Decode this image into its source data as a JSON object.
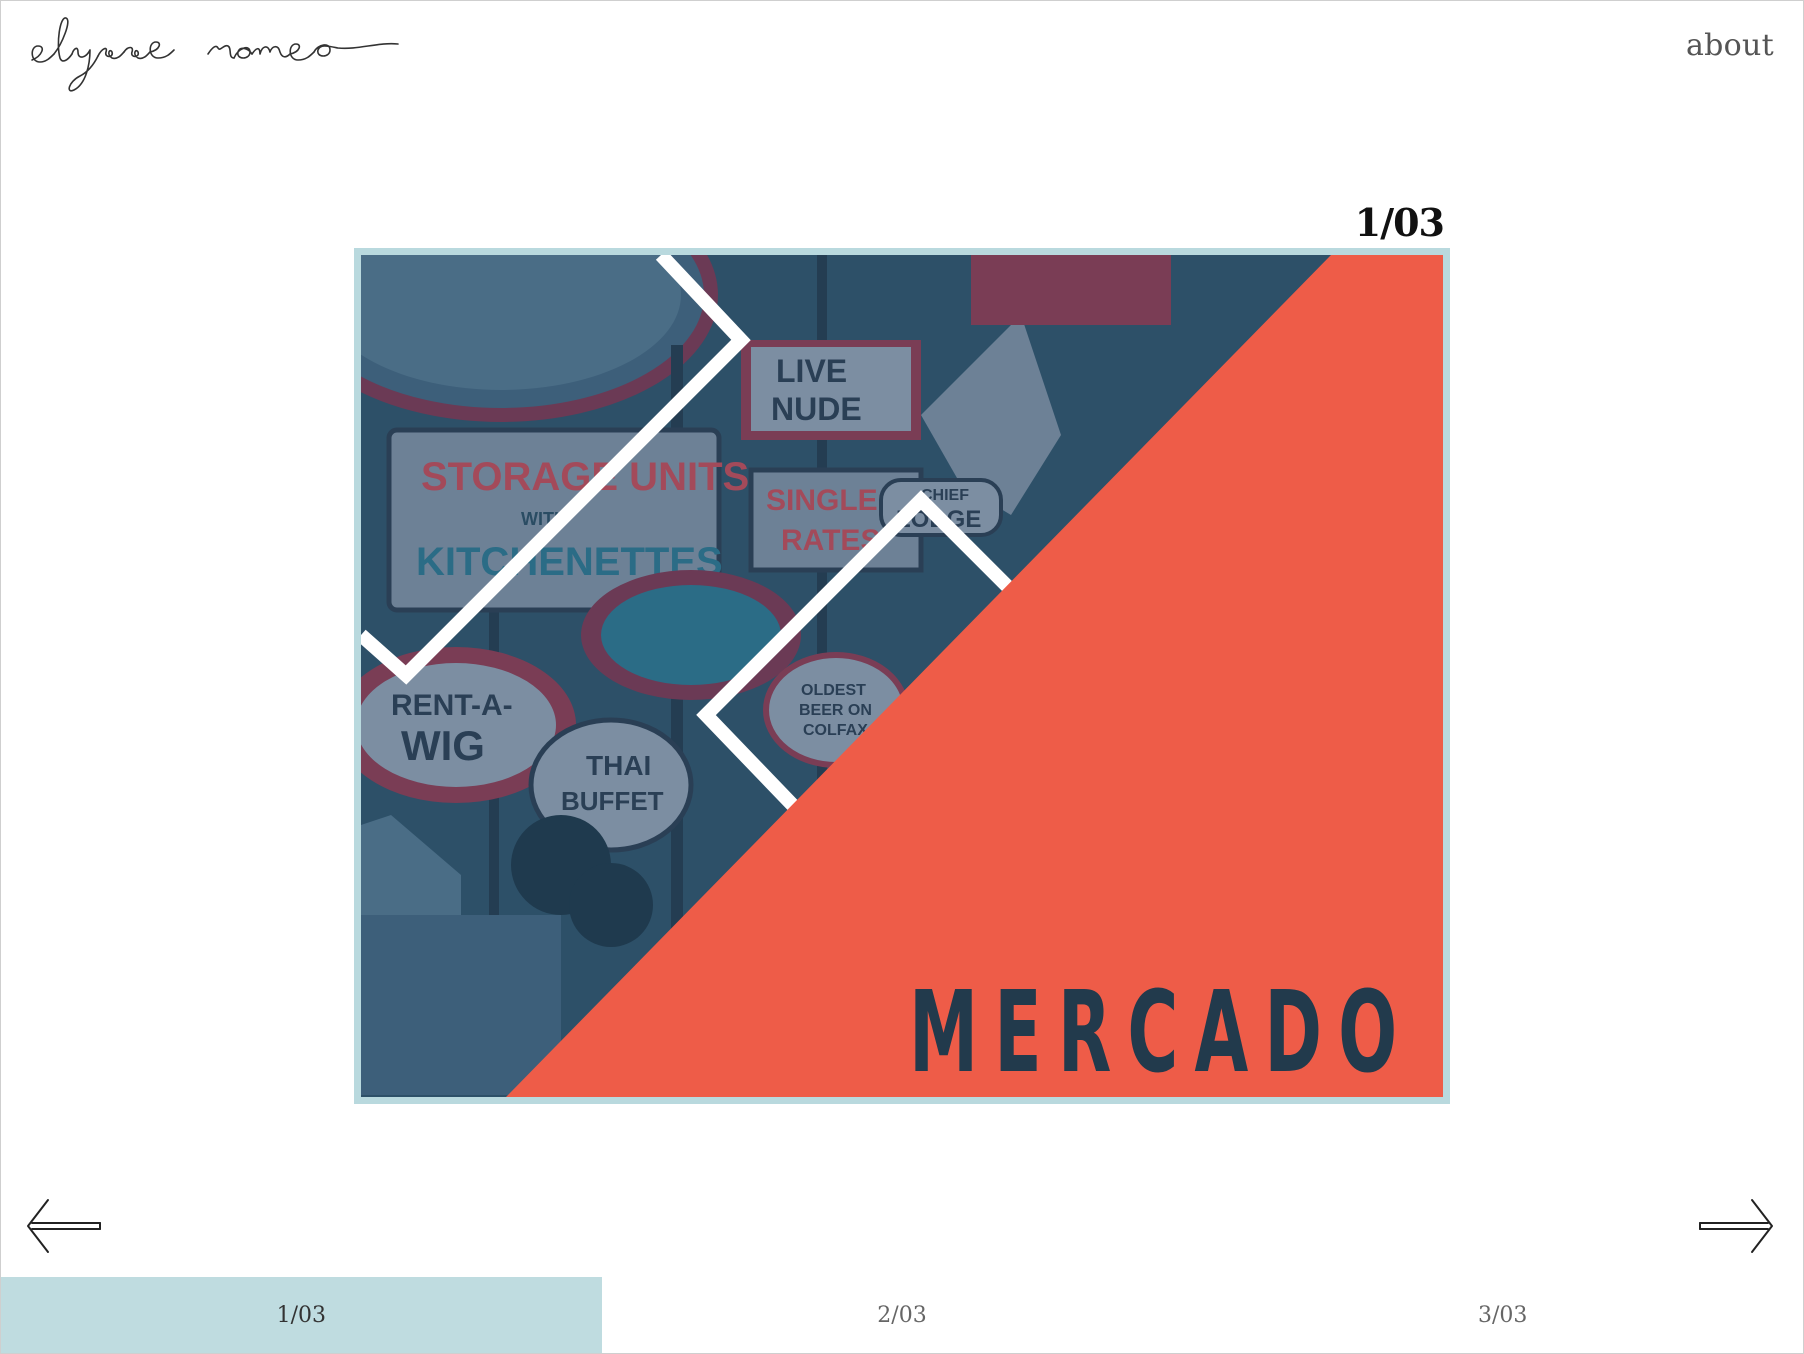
{
  "header": {
    "logo_text": "elysse romeo",
    "about_label": "about"
  },
  "slide": {
    "counter": "1/03",
    "title": "MERCADO",
    "signs": [
      "STORAGE UNITS",
      "WITH",
      "KITCHENETTES",
      "LIVE",
      "NUDE",
      "SINGLE",
      "RATES",
      "RENT-A-",
      "WIG",
      "THAI",
      "BUFFET",
      "CHIEF",
      "LODGE",
      "OLDEST",
      "BEER ON",
      "COLFAX"
    ]
  },
  "pager": {
    "items": [
      {
        "label": "1/03",
        "active": true
      },
      {
        "label": "2/03",
        "active": false
      },
      {
        "label": "3/03",
        "active": false
      }
    ]
  },
  "colors": {
    "accent_blue": "#bfdce0",
    "coral": "#ee5c48",
    "navy": "#223a4c",
    "art_blue": "#2a4c63"
  },
  "icons": {
    "prev": "arrow-left-icon",
    "next": "arrow-right-icon"
  }
}
